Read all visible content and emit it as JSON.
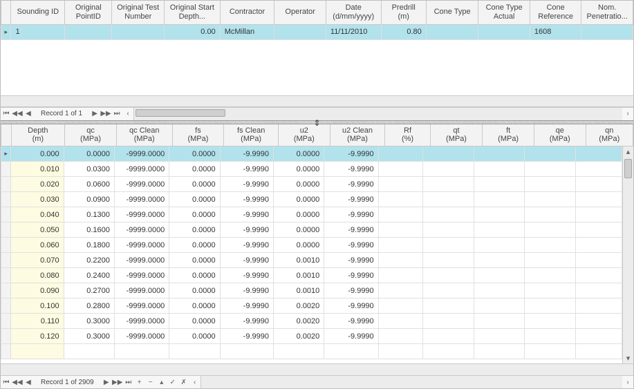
{
  "upper": {
    "columns": [
      "Sounding ID",
      "Original\nPointID",
      "Original Test\nNumber",
      "Original Start\nDepth...",
      "Contractor",
      "Operator",
      "Date\n(d/mm/yyyy)",
      "Predrill\n(m)",
      "Cone Type",
      "Cone Type\nActual",
      "Cone\nReference",
      "Nom.\nPenetratio..."
    ],
    "widths": [
      75,
      66,
      73,
      78,
      76,
      72,
      77,
      63,
      73,
      72,
      72,
      72
    ],
    "row": {
      "sounding_id": "1",
      "orig_point": "",
      "orig_test": "",
      "orig_start_depth": "0.00",
      "contractor": "McMillan",
      "operator": "",
      "date": "11/11/2010",
      "predrill": "0.80",
      "cone_type": "",
      "cone_type_actual": "",
      "cone_ref": "1608",
      "nom_pen": ""
    },
    "nav_label": "Record 1 of 1"
  },
  "lower": {
    "columns": [
      "Depth\n(m)",
      "qc\n(MPa)",
      "qc Clean\n(MPa)",
      "fs\n(MPa)",
      "fs Clean\n(MPa)",
      "u2\n(MPa)",
      "u2 Clean\n(MPa)",
      "Rf\n(%)",
      "qt\n(MPa)",
      "ft\n(MPa)",
      "qe\n(MPa)",
      "qn\n(MPa)"
    ],
    "widths": [
      75,
      72,
      78,
      72,
      76,
      72,
      77,
      63,
      73,
      72,
      72,
      66
    ],
    "rows": [
      {
        "depth": "0.000",
        "qc": "0.0000",
        "qcc": "-9999.0000",
        "fs": "0.0000",
        "fsc": "-9.9990",
        "u2": "0.0000",
        "u2c": "-9.9990",
        "rf": "",
        "qt": "",
        "ft": "",
        "qe": "",
        "qn": ""
      },
      {
        "depth": "0.010",
        "qc": "0.0300",
        "qcc": "-9999.0000",
        "fs": "0.0000",
        "fsc": "-9.9990",
        "u2": "0.0000",
        "u2c": "-9.9990",
        "rf": "",
        "qt": "",
        "ft": "",
        "qe": "",
        "qn": ""
      },
      {
        "depth": "0.020",
        "qc": "0.0600",
        "qcc": "-9999.0000",
        "fs": "0.0000",
        "fsc": "-9.9990",
        "u2": "0.0000",
        "u2c": "-9.9990",
        "rf": "",
        "qt": "",
        "ft": "",
        "qe": "",
        "qn": ""
      },
      {
        "depth": "0.030",
        "qc": "0.0900",
        "qcc": "-9999.0000",
        "fs": "0.0000",
        "fsc": "-9.9990",
        "u2": "0.0000",
        "u2c": "-9.9990",
        "rf": "",
        "qt": "",
        "ft": "",
        "qe": "",
        "qn": ""
      },
      {
        "depth": "0.040",
        "qc": "0.1300",
        "qcc": "-9999.0000",
        "fs": "0.0000",
        "fsc": "-9.9990",
        "u2": "0.0000",
        "u2c": "-9.9990",
        "rf": "",
        "qt": "",
        "ft": "",
        "qe": "",
        "qn": ""
      },
      {
        "depth": "0.050",
        "qc": "0.1600",
        "qcc": "-9999.0000",
        "fs": "0.0000",
        "fsc": "-9.9990",
        "u2": "0.0000",
        "u2c": "-9.9990",
        "rf": "",
        "qt": "",
        "ft": "",
        "qe": "",
        "qn": ""
      },
      {
        "depth": "0.060",
        "qc": "0.1800",
        "qcc": "-9999.0000",
        "fs": "0.0000",
        "fsc": "-9.9990",
        "u2": "0.0000",
        "u2c": "-9.9990",
        "rf": "",
        "qt": "",
        "ft": "",
        "qe": "",
        "qn": ""
      },
      {
        "depth": "0.070",
        "qc": "0.2200",
        "qcc": "-9999.0000",
        "fs": "0.0000",
        "fsc": "-9.9990",
        "u2": "0.0010",
        "u2c": "-9.9990",
        "rf": "",
        "qt": "",
        "ft": "",
        "qe": "",
        "qn": ""
      },
      {
        "depth": "0.080",
        "qc": "0.2400",
        "qcc": "-9999.0000",
        "fs": "0.0000",
        "fsc": "-9.9990",
        "u2": "0.0010",
        "u2c": "-9.9990",
        "rf": "",
        "qt": "",
        "ft": "",
        "qe": "",
        "qn": ""
      },
      {
        "depth": "0.090",
        "qc": "0.2700",
        "qcc": "-9999.0000",
        "fs": "0.0000",
        "fsc": "-9.9990",
        "u2": "0.0010",
        "u2c": "-9.9990",
        "rf": "",
        "qt": "",
        "ft": "",
        "qe": "",
        "qn": ""
      },
      {
        "depth": "0.100",
        "qc": "0.2800",
        "qcc": "-9999.0000",
        "fs": "0.0000",
        "fsc": "-9.9990",
        "u2": "0.0020",
        "u2c": "-9.9990",
        "rf": "",
        "qt": "",
        "ft": "",
        "qe": "",
        "qn": ""
      },
      {
        "depth": "0.110",
        "qc": "0.3000",
        "qcc": "-9999.0000",
        "fs": "0.0000",
        "fsc": "-9.9990",
        "u2": "0.0020",
        "u2c": "-9.9990",
        "rf": "",
        "qt": "",
        "ft": "",
        "qe": "",
        "qn": ""
      },
      {
        "depth": "0.120",
        "qc": "0.3000",
        "qcc": "-9999.0000",
        "fs": "0.0000",
        "fsc": "-9.9990",
        "u2": "0.0020",
        "u2c": "-9.9990",
        "rf": "",
        "qt": "",
        "ft": "",
        "qe": "",
        "qn": ""
      }
    ],
    "nav_label": "Record 1 of 2909"
  },
  "icons": {
    "first": "⏮",
    "prev_page": "◀◀",
    "prev": "◀",
    "next": "▶",
    "next_page": "▶▶",
    "last": "⏭",
    "plus": "+",
    "minus": "−",
    "check": "✓",
    "cancel": "✗",
    "chevron_left": "‹",
    "chevron_right": "›",
    "split": "⇕",
    "up": "▴",
    "down": "▾",
    "right": "▸"
  }
}
